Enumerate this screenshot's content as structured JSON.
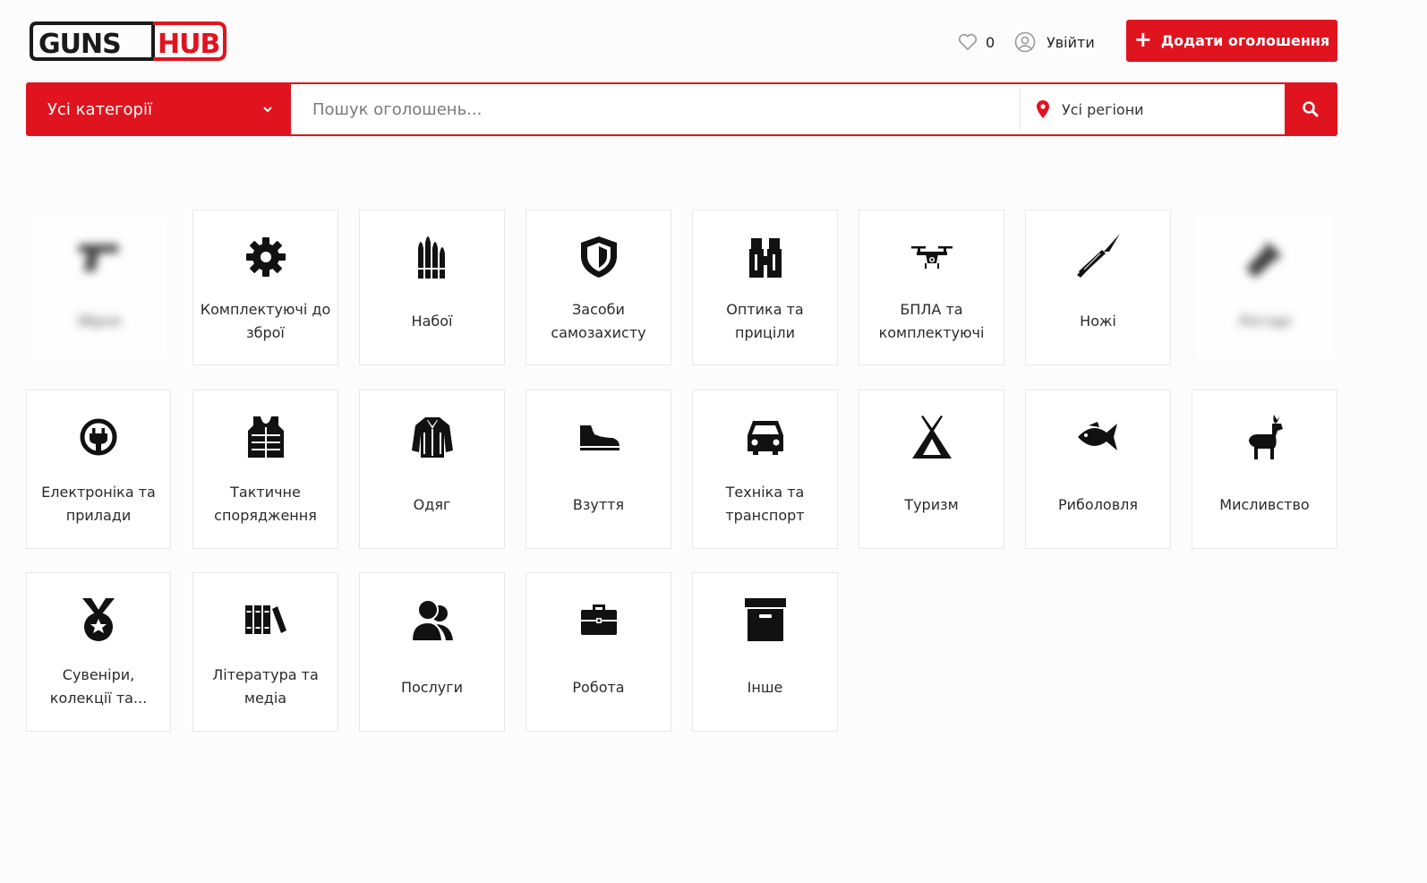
{
  "header": {
    "logo_text_dark": "GUNS",
    "logo_text_red": "HUB",
    "favorites_count": "0",
    "login_label": "Увійти",
    "add_listing_label": "Додати оголошення"
  },
  "search": {
    "category_label": "Усі категорії",
    "placeholder": "Пошук оголошень...",
    "region_label": "Усі регіони"
  },
  "colors": {
    "brand_red": "#e0141f",
    "dark": "#1a1a1a"
  },
  "categories": [
    {
      "label": "Зброя",
      "icon": "pistol-icon",
      "blurred": true
    },
    {
      "label": "Комплектуючі до зброї",
      "icon": "gear-icon"
    },
    {
      "label": "Набої",
      "icon": "bullets-icon"
    },
    {
      "label": "Засоби самозахисту",
      "icon": "shield-icon"
    },
    {
      "label": "Оптика та приціли",
      "icon": "binoculars-icon"
    },
    {
      "label": "БПЛА та комплектуючі",
      "icon": "drone-icon"
    },
    {
      "label": "Ножі",
      "icon": "knife-icon"
    },
    {
      "label": "Ліхтарі",
      "icon": "flashlight-icon",
      "blurred": true
    },
    {
      "label": "Електроніка та прилади",
      "icon": "power-plug-icon"
    },
    {
      "label": "Тактичне спорядження",
      "icon": "vest-icon"
    },
    {
      "label": "Одяг",
      "icon": "jacket-icon"
    },
    {
      "label": "Взуття",
      "icon": "shoe-icon"
    },
    {
      "label": "Техніка та транспорт",
      "icon": "car-icon"
    },
    {
      "label": "Туризм",
      "icon": "tent-icon"
    },
    {
      "label": "Риболовля",
      "icon": "fish-icon"
    },
    {
      "label": "Мисливство",
      "icon": "deer-icon"
    },
    {
      "label": "Сувеніри, колекції та...",
      "icon": "medal-icon"
    },
    {
      "label": "Література та медіа",
      "icon": "books-icon"
    },
    {
      "label": "Послуги",
      "icon": "users-icon"
    },
    {
      "label": "Робота",
      "icon": "briefcase-icon"
    },
    {
      "label": "Інше",
      "icon": "archive-box-icon"
    }
  ]
}
